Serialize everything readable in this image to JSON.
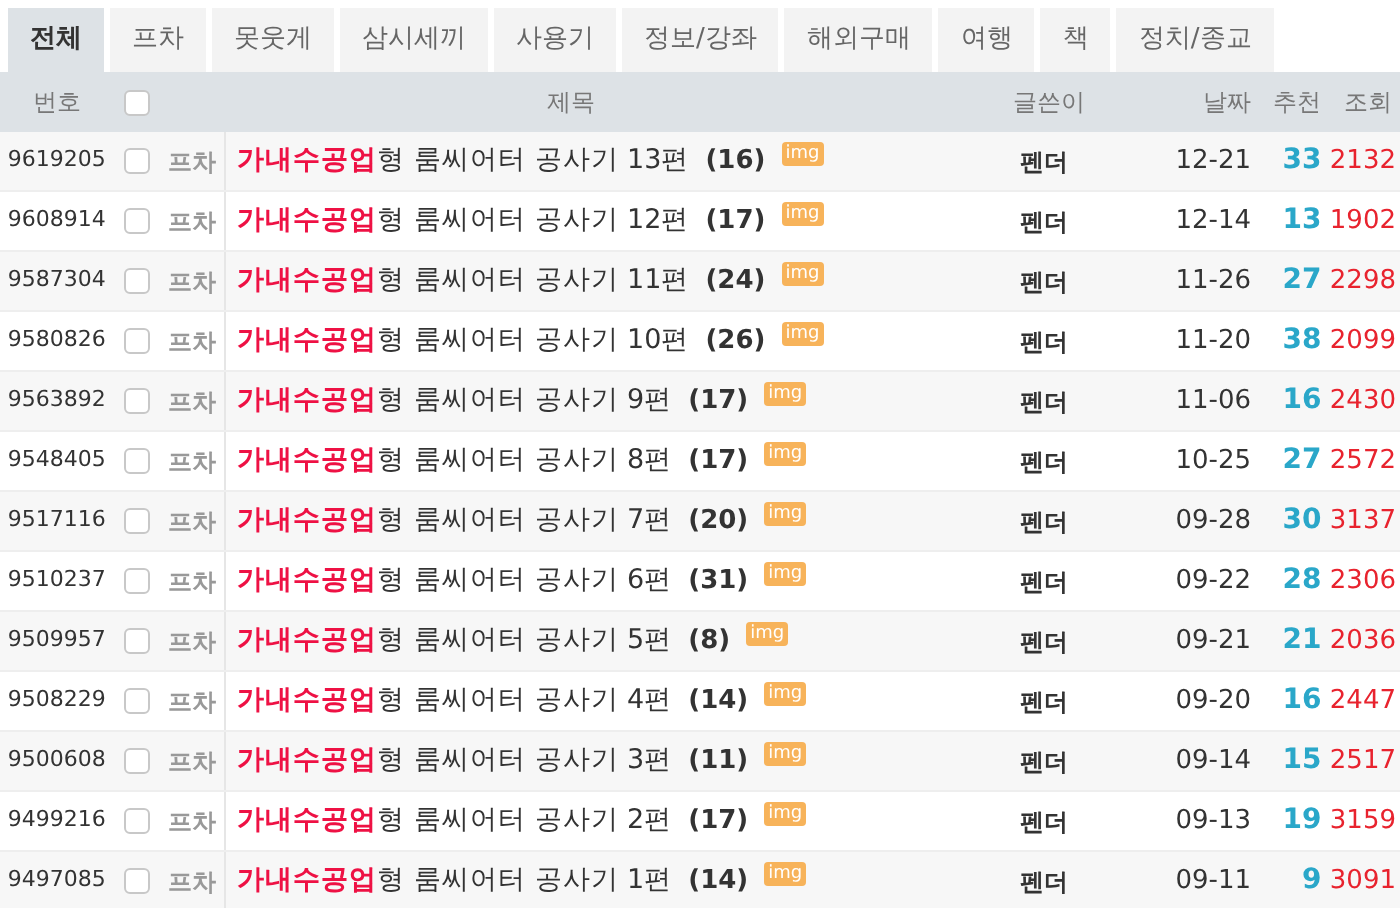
{
  "tabs": [
    {
      "label": "전체",
      "selected": true
    },
    {
      "label": "프차",
      "selected": false
    },
    {
      "label": "못웃게",
      "selected": false
    },
    {
      "label": "삼시세끼",
      "selected": false
    },
    {
      "label": "사용기",
      "selected": false
    },
    {
      "label": "정보/강좌",
      "selected": false
    },
    {
      "label": "해외구매",
      "selected": false
    },
    {
      "label": "여행",
      "selected": false
    },
    {
      "label": "책",
      "selected": false
    },
    {
      "label": "정치/종교",
      "selected": false
    }
  ],
  "table": {
    "columns": [
      "번호",
      "제목",
      "글쓴이",
      "날짜",
      "추천",
      "조회"
    ],
    "select_all_checked": false,
    "rows": [
      {
        "number": "9619205",
        "checked": false,
        "category": "프차",
        "prefix": "가내수공업",
        "title": "형 룸씨어터 공사기 13편",
        "comments": "(16)",
        "badge": "img",
        "author": "펜더",
        "date": "12-21",
        "likes": "33",
        "views": "2132"
      },
      {
        "number": "9608914",
        "checked": false,
        "category": "프차",
        "prefix": "가내수공업",
        "title": "형 룸씨어터 공사기 12편",
        "comments": "(17)",
        "badge": "img",
        "author": "펜더",
        "date": "12-14",
        "likes": "13",
        "views": "1902"
      },
      {
        "number": "9587304",
        "checked": false,
        "category": "프차",
        "prefix": "가내수공업",
        "title": "형 룸씨어터 공사기 11편",
        "comments": "(24)",
        "badge": "img",
        "author": "펜더",
        "date": "11-26",
        "likes": "27",
        "views": "2298"
      },
      {
        "number": "9580826",
        "checked": false,
        "category": "프차",
        "prefix": "가내수공업",
        "title": "형 룸씨어터 공사기 10편",
        "comments": "(26)",
        "badge": "img",
        "author": "펜더",
        "date": "11-20",
        "likes": "38",
        "views": "2099"
      },
      {
        "number": "9563892",
        "checked": false,
        "category": "프차",
        "prefix": "가내수공업",
        "title": "형 룸씨어터 공사기 9편",
        "comments": "(17)",
        "badge": "img",
        "author": "펜더",
        "date": "11-06",
        "likes": "16",
        "views": "2430"
      },
      {
        "number": "9548405",
        "checked": false,
        "category": "프차",
        "prefix": "가내수공업",
        "title": "형 룸씨어터 공사기 8편",
        "comments": "(17)",
        "badge": "img",
        "author": "펜더",
        "date": "10-25",
        "likes": "27",
        "views": "2572"
      },
      {
        "number": "9517116",
        "checked": false,
        "category": "프차",
        "prefix": "가내수공업",
        "title": "형 룸씨어터 공사기 7편",
        "comments": "(20)",
        "badge": "img",
        "author": "펜더",
        "date": "09-28",
        "likes": "30",
        "views": "3137"
      },
      {
        "number": "9510237",
        "checked": false,
        "category": "프차",
        "prefix": "가내수공업",
        "title": "형 룸씨어터 공사기 6편",
        "comments": "(31)",
        "badge": "img",
        "author": "펜더",
        "date": "09-22",
        "likes": "28",
        "views": "2306"
      },
      {
        "number": "9509957",
        "checked": false,
        "category": "프차",
        "prefix": "가내수공업",
        "title": "형 룸씨어터 공사기 5편",
        "comments": "(8)",
        "badge": "img",
        "author": "펜더",
        "date": "09-21",
        "likes": "21",
        "views": "2036"
      },
      {
        "number": "9508229",
        "checked": false,
        "category": "프차",
        "prefix": "가내수공업",
        "title": "형 룸씨어터 공사기 4편",
        "comments": "(14)",
        "badge": "img",
        "author": "펜더",
        "date": "09-20",
        "likes": "16",
        "views": "2447"
      },
      {
        "number": "9500608",
        "checked": false,
        "category": "프차",
        "prefix": "가내수공업",
        "title": "형 룸씨어터 공사기 3편",
        "comments": "(11)",
        "badge": "img",
        "author": "펜더",
        "date": "09-14",
        "likes": "15",
        "views": "2517"
      },
      {
        "number": "9499216",
        "checked": false,
        "category": "프차",
        "prefix": "가내수공업",
        "title": "형 룸씨어터 공사기 2편",
        "comments": "(17)",
        "badge": "img",
        "author": "펜더",
        "date": "09-13",
        "likes": "19",
        "views": "3159"
      },
      {
        "number": "9497085",
        "checked": false,
        "category": "프차",
        "prefix": "가내수공업",
        "title": "형 룸씨어터 공사기 1편",
        "comments": "(14)",
        "badge": "img",
        "author": "펜더",
        "date": "09-11",
        "likes": "9",
        "views": "3091"
      }
    ]
  }
}
